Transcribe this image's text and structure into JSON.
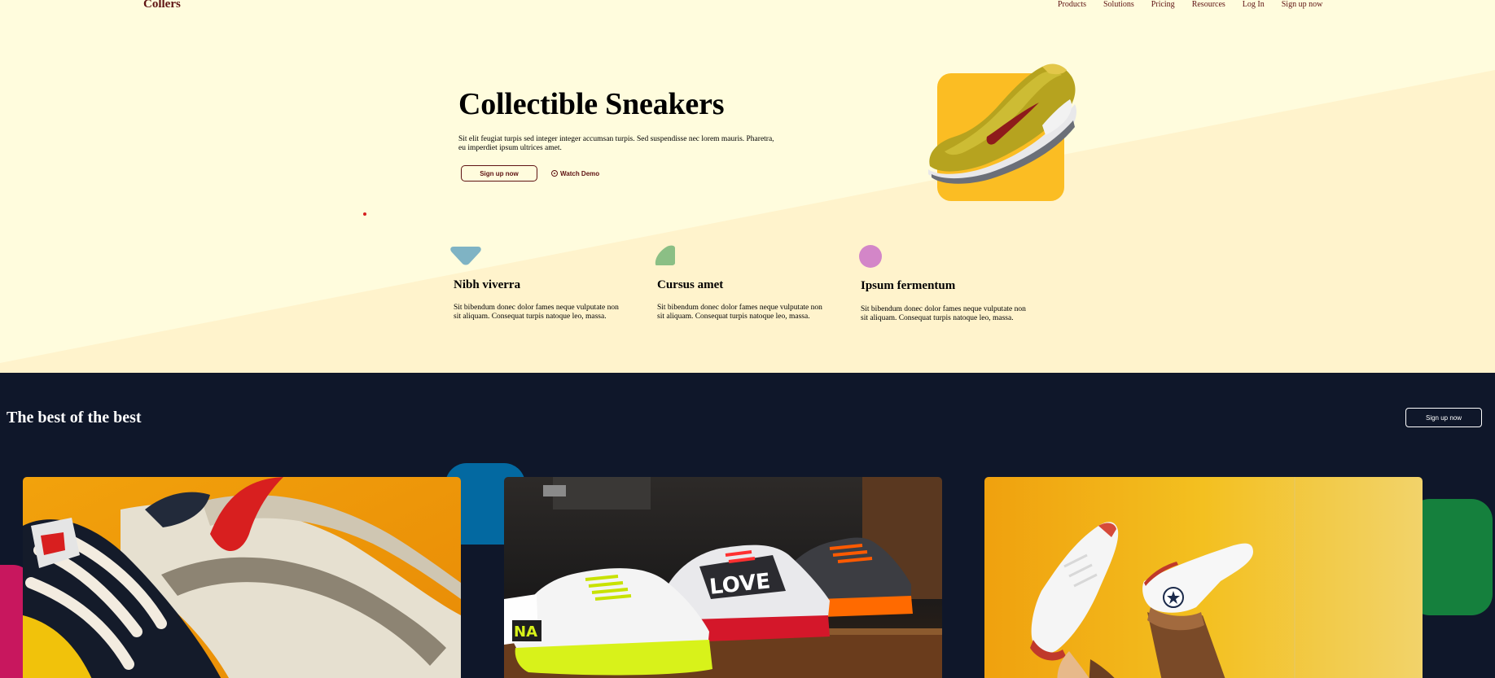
{
  "nav": {
    "brand": "Collers",
    "links": [
      "Products",
      "Solutions",
      "Pricing",
      "Resources",
      "Log In",
      "Sign up now"
    ]
  },
  "hero": {
    "title": "Collectible Sneakers",
    "description": "Sit elit feugiat turpis sed integer integer accumsan turpis. Sed suspendisse nec lorem mauris. Pharetra, eu imperdiet ipsum ultrices amet.",
    "primary_button": "Sign up now",
    "secondary_button": "Watch Demo"
  },
  "features": [
    {
      "icon": "blue-badge-icon",
      "color": "#7fb3c4",
      "title": "Nibh viverra",
      "description": "Sit bibendum donec dolor fames neque vulputate non sit aliquam. Consequat turpis natoque leo, massa."
    },
    {
      "icon": "green-leaf-icon",
      "color": "#8bbf85",
      "title": "Cursus amet",
      "description": "Sit bibendum donec dolor fames neque vulputate non sit aliquam. Consequat turpis natoque leo, massa."
    },
    {
      "icon": "pink-circle-icon",
      "color": "#d386c8",
      "title": "Ipsum fermentum",
      "description": "Sit bibendum donec dolor fames neque vulputate non sit aliquam. Consequat turpis natoque leo, massa."
    }
  ],
  "showcase": {
    "title": "The best of the best",
    "button": "Sign up now",
    "photos": [
      {
        "name": "sneaker-closeup-photo"
      },
      {
        "name": "sneakers-shelf-photo"
      },
      {
        "name": "high-tops-photo"
      }
    ]
  },
  "colors": {
    "cream": "#fffcdd",
    "cream_shadow": "#fff3cc",
    "maroon": "#5e1212",
    "navy": "#0f172a",
    "amber": "#fbbd23"
  }
}
